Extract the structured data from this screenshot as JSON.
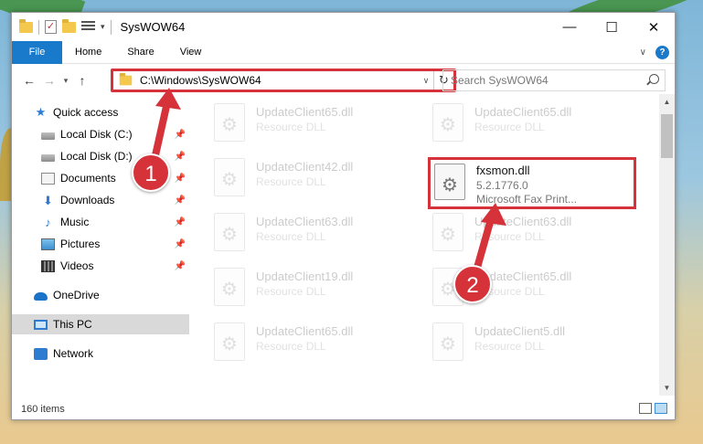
{
  "window": {
    "title": "SysWOW64",
    "controls": {
      "minimize": "—",
      "maximize": "☐",
      "close": "✕"
    }
  },
  "ribbon": {
    "tabs": [
      "File",
      "Home",
      "Share",
      "View"
    ]
  },
  "address": {
    "path": "C:\\Windows\\SysWOW64",
    "search_placeholder": "Search SysWOW64"
  },
  "sidebar": {
    "items": [
      {
        "label": "Quick access",
        "icon": "star-icon",
        "pinned": false
      },
      {
        "label": "Local Disk (C:)",
        "icon": "disk-icon",
        "pinned": true
      },
      {
        "label": "Local Disk (D:)",
        "icon": "disk-icon",
        "pinned": true
      },
      {
        "label": "Documents",
        "icon": "documents-icon",
        "pinned": true
      },
      {
        "label": "Downloads",
        "icon": "download-icon",
        "pinned": true
      },
      {
        "label": "Music",
        "icon": "music-icon",
        "pinned": true
      },
      {
        "label": "Pictures",
        "icon": "pictures-icon",
        "pinned": true
      },
      {
        "label": "Videos",
        "icon": "videos-icon",
        "pinned": true
      },
      {
        "label": "OneDrive",
        "icon": "onedrive-icon",
        "pinned": false
      },
      {
        "label": "This PC",
        "icon": "pc-icon",
        "pinned": false,
        "selected": true
      },
      {
        "label": "Network",
        "icon": "network-icon",
        "pinned": false
      }
    ]
  },
  "files": [
    {
      "name": "UpdateClient65.dll",
      "meta": "Resource DLL"
    },
    {
      "name": "UpdateClient65.dll",
      "meta": "Resource DLL"
    },
    {
      "name": "UpdateClient42.dll",
      "meta": "Resource DLL"
    },
    {
      "name": "fxsmon.dll",
      "meta": "5.2.1776.0",
      "meta2": "Microsoft Fax Print...",
      "highlight": true
    },
    {
      "name": "UpdateClient63.dll",
      "meta": "Resource DLL"
    },
    {
      "name": "UpdateClient63.dll",
      "meta": "Resource DLL"
    },
    {
      "name": "UpdateClient19.dll",
      "meta": "Resource DLL"
    },
    {
      "name": "UpdateClient65.dll",
      "meta": "Resource DLL"
    },
    {
      "name": "UpdateClient65.dll",
      "meta": "Resource DLL"
    },
    {
      "name": "UpdateClient5.dll",
      "meta": "Resource DLL"
    }
  ],
  "status": {
    "item_count": "160 items"
  },
  "callouts": [
    "1",
    "2"
  ],
  "colors": {
    "accent": "#1979ca",
    "highlight": "#d5323a"
  }
}
